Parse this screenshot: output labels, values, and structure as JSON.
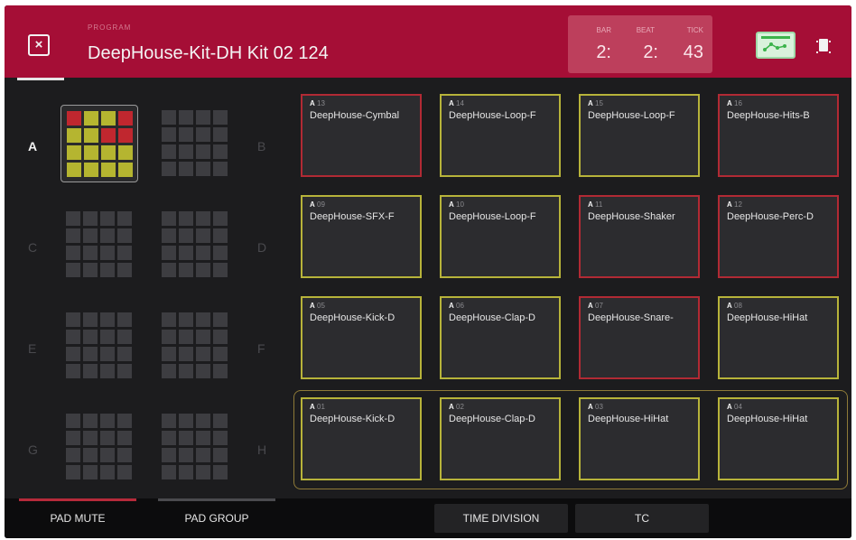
{
  "header": {
    "program_caption": "PROGRAM",
    "program_name": "DeepHouse-Kit-DH Kit 02 124",
    "close_label": "×",
    "counter": {
      "bar_label": "BAR",
      "bar_value": "2:",
      "beat_label": "BEAT",
      "beat_value": "2:",
      "tick_label": "TICK",
      "tick_value": "43"
    }
  },
  "banks": [
    {
      "letter": "A",
      "active": true
    },
    {
      "letter": "B",
      "active": false
    },
    {
      "letter": "C",
      "active": false
    },
    {
      "letter": "D",
      "active": false
    },
    {
      "letter": "E",
      "active": false
    },
    {
      "letter": "F",
      "active": false
    },
    {
      "letter": "G",
      "active": false
    },
    {
      "letter": "H",
      "active": false
    }
  ],
  "bank_a_cells": [
    "red",
    "yellow",
    "yellow",
    "red",
    "yellow",
    "yellow",
    "red",
    "red",
    "yellow",
    "yellow",
    "yellow",
    "yellow",
    "yellow",
    "yellow",
    "yellow",
    "yellow"
  ],
  "colors": {
    "red": "#c0272f",
    "yellow": "#b5b530",
    "inactive_cell": "#3d3d41",
    "header": "#a50e36",
    "pad_border_yellow": "#b7b33a",
    "pad_border_red": "#b12a34"
  },
  "pads": [
    {
      "bank": "A",
      "num": "13",
      "name": "DeepHouse-Cymbal",
      "border": "red"
    },
    {
      "bank": "A",
      "num": "14",
      "name": "DeepHouse-Loop-F",
      "border": "yellow"
    },
    {
      "bank": "A",
      "num": "15",
      "name": "DeepHouse-Loop-F",
      "border": "yellow"
    },
    {
      "bank": "A",
      "num": "16",
      "name": "DeepHouse-Hits-B",
      "border": "red"
    },
    {
      "bank": "A",
      "num": "09",
      "name": "DeepHouse-SFX-F",
      "border": "yellow"
    },
    {
      "bank": "A",
      "num": "10",
      "name": "DeepHouse-Loop-F",
      "border": "yellow"
    },
    {
      "bank": "A",
      "num": "11",
      "name": "DeepHouse-Shaker",
      "border": "red"
    },
    {
      "bank": "A",
      "num": "12",
      "name": "DeepHouse-Perc-D",
      "border": "red"
    },
    {
      "bank": "A",
      "num": "05",
      "name": "DeepHouse-Kick-D",
      "border": "yellow"
    },
    {
      "bank": "A",
      "num": "06",
      "name": "DeepHouse-Clap-D",
      "border": "yellow"
    },
    {
      "bank": "A",
      "num": "07",
      "name": "DeepHouse-Snare-",
      "border": "red"
    },
    {
      "bank": "A",
      "num": "08",
      "name": "DeepHouse-HiHat",
      "border": "yellow"
    },
    {
      "bank": "A",
      "num": "01",
      "name": "DeepHouse-Kick-D",
      "border": "yellow"
    },
    {
      "bank": "A",
      "num": "02",
      "name": "DeepHouse-Clap-D",
      "border": "yellow"
    },
    {
      "bank": "A",
      "num": "03",
      "name": "DeepHouse-HiHat",
      "border": "yellow"
    },
    {
      "bank": "A",
      "num": "04",
      "name": "DeepHouse-HiHat",
      "border": "yellow"
    }
  ],
  "bottom": {
    "pad_mute": "PAD MUTE",
    "pad_group": "PAD GROUP",
    "time_division": "TIME DIVISION",
    "tc": "TC"
  }
}
